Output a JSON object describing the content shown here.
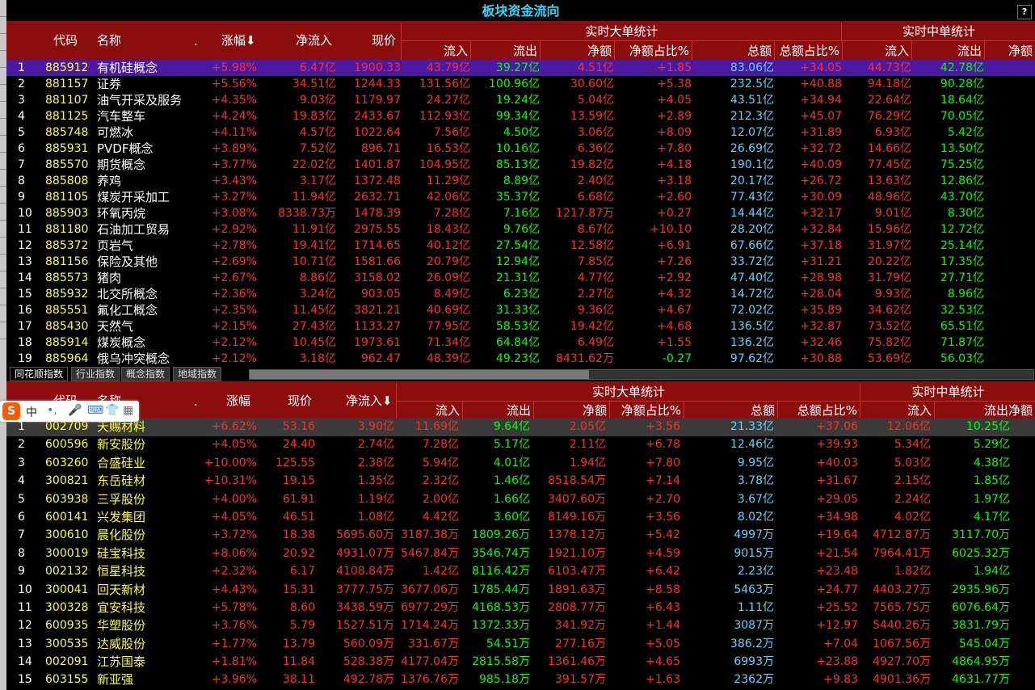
{
  "title": "板块资金流向",
  "help_label": "?",
  "unit_yi": "亿",
  "unit_wan": "万",
  "top": {
    "headers": {
      "seq": "",
      "code": "代码",
      "name": "名称",
      "dot": ".",
      "chg": "涨幅",
      "net": "净流入",
      "price": "现价",
      "big_group": "实时大单统计",
      "mid_group": "实时中单统计",
      "big_sub": [
        "流入",
        "流出",
        "净额",
        "净额占比%",
        "总额",
        "总额占比%"
      ],
      "mid_sub": [
        "流入",
        "流出",
        "净额"
      ]
    },
    "sort_arrow": "⬇",
    "rows": [
      [
        "1",
        "885912",
        "有机硅概念",
        "+5.98%",
        "6.47亿",
        "1900.33",
        "43.79亿",
        "39.27亿",
        "4.51亿",
        "+1.85",
        "83.06亿",
        "+34.05",
        "44.73亿",
        "42.78亿"
      ],
      [
        "2",
        "881157",
        "证券",
        "+5.56%",
        "34.51亿",
        "1244.33",
        "131.56亿",
        "100.96亿",
        "30.60亿",
        "+5.38",
        "232.5亿",
        "+40.88",
        "94.18亿",
        "90.28亿"
      ],
      [
        "3",
        "881107",
        "油气开采及服务",
        "+4.35%",
        "9.03亿",
        "1179.97",
        "24.27亿",
        "19.24亿",
        "5.04亿",
        "+4.05",
        "43.51亿",
        "+34.94",
        "22.64亿",
        "18.64亿"
      ],
      [
        "4",
        "881125",
        "汽车整车",
        "+4.24%",
        "19.83亿",
        "2433.67",
        "112.93亿",
        "99.34亿",
        "13.59亿",
        "+2.89",
        "212.3亿",
        "+45.07",
        "76.29亿",
        "70.05亿"
      ],
      [
        "5",
        "885748",
        "可燃冰",
        "+4.11%",
        "4.57亿",
        "1022.64",
        "7.56亿",
        "4.50亿",
        "3.06亿",
        "+8.09",
        "12.07亿",
        "+31.89",
        "6.93亿",
        "5.42亿"
      ],
      [
        "6",
        "885931",
        "PVDF概念",
        "+3.89%",
        "7.52亿",
        "896.71",
        "16.53亿",
        "10.16亿",
        "6.36亿",
        "+7.80",
        "26.69亿",
        "+32.72",
        "14.66亿",
        "13.50亿"
      ],
      [
        "7",
        "885570",
        "期货概念",
        "+3.77%",
        "22.02亿",
        "1401.87",
        "104.95亿",
        "85.13亿",
        "19.82亿",
        "+4.18",
        "190.1亿",
        "+40.09",
        "77.45亿",
        "75.25亿"
      ],
      [
        "8",
        "885808",
        "养鸡",
        "+3.43%",
        "3.17亿",
        "1372.48",
        "11.29亿",
        "8.89亿",
        "2.40亿",
        "+3.18",
        "20.17亿",
        "+26.72",
        "13.63亿",
        "12.86亿"
      ],
      [
        "9",
        "881105",
        "煤炭开采加工",
        "+3.27%",
        "11.94亿",
        "2632.71",
        "42.06亿",
        "35.37亿",
        "6.68亿",
        "+2.60",
        "77.43亿",
        "+30.09",
        "48.96亿",
        "43.70亿"
      ],
      [
        "10",
        "885903",
        "环氧丙烷",
        "+3.08%",
        "8338.73万",
        "1478.39",
        "7.28亿",
        "7.16亿",
        "1217.87万",
        "+0.27",
        "14.44亿",
        "+32.17",
        "9.01亿",
        "8.30亿"
      ],
      [
        "11",
        "881180",
        "石油加工贸易",
        "+2.92%",
        "11.91亿",
        "2975.55",
        "18.43亿",
        "9.76亿",
        "8.67亿",
        "+10.10",
        "28.20亿",
        "+32.84",
        "15.96亿",
        "12.72亿"
      ],
      [
        "12",
        "885372",
        "页岩气",
        "+2.78%",
        "19.41亿",
        "1714.65",
        "40.12亿",
        "27.54亿",
        "12.58亿",
        "+6.91",
        "67.66亿",
        "+37.18",
        "31.97亿",
        "25.14亿"
      ],
      [
        "13",
        "881156",
        "保险及其他",
        "+2.69%",
        "10.71亿",
        "1581.66",
        "20.79亿",
        "12.94亿",
        "7.85亿",
        "+7.26",
        "33.72亿",
        "+31.21",
        "20.22亿",
        "17.35亿"
      ],
      [
        "14",
        "885573",
        "猪肉",
        "+2.67%",
        "8.86亿",
        "3158.02",
        "26.09亿",
        "21.31亿",
        "4.77亿",
        "+2.92",
        "47.40亿",
        "+28.98",
        "31.79亿",
        "27.71亿"
      ],
      [
        "15",
        "885932",
        "北交所概念",
        "+2.36%",
        "3.24亿",
        "903.05",
        "8.49亿",
        "6.23亿",
        "2.27亿",
        "+4.32",
        "14.72亿",
        "+28.04",
        "9.93亿",
        "8.96亿"
      ],
      [
        "16",
        "885551",
        "氟化工概念",
        "+2.35%",
        "11.45亿",
        "3821.21",
        "40.69亿",
        "31.33亿",
        "9.36亿",
        "+4.67",
        "72.02亿",
        "+35.89",
        "34.62亿",
        "32.53亿"
      ],
      [
        "17",
        "885430",
        "天然气",
        "+2.15%",
        "27.43亿",
        "1133.27",
        "77.95亿",
        "58.53亿",
        "19.42亿",
        "+4.68",
        "136.5亿",
        "+32.87",
        "73.52亿",
        "65.51亿"
      ],
      [
        "18",
        "885914",
        "煤炭概念",
        "+2.12%",
        "10.45亿",
        "1973.61",
        "71.34亿",
        "64.84亿",
        "6.49亿",
        "+1.55",
        "136.2亿",
        "+32.46",
        "75.82亿",
        "71.87亿"
      ],
      [
        "19",
        "885964",
        "俄乌冲突概念",
        "+2.12%",
        "3.18亿",
        "962.47",
        "48.39亿",
        "49.23亿",
        "8431.62万",
        "-0.27",
        "97.62亿",
        "+30.88",
        "53.69亿",
        "56.03亿"
      ]
    ]
  },
  "tabs": [
    "同花顺指数",
    "行业指数",
    "概念指数",
    "地域指数"
  ],
  "ime": {
    "logo": "S",
    "lang": "中",
    "punct": "•,",
    "mic": "🎤",
    "kbd": "⌨",
    "skin": "👕",
    "apps": "▦"
  },
  "bottom": {
    "headers": {
      "code": "代码",
      "name": "名称",
      "dot": ".",
      "chg": "涨幅",
      "price": "现价",
      "net": "净流入",
      "big_group": "实时大单统计",
      "mid_group": "实时中单统计",
      "big_sub": [
        "流入",
        "流出",
        "净额",
        "净额占比%",
        "总额",
        "总额占比%"
      ],
      "mid_sub": [
        "流入",
        "流出净额"
      ]
    },
    "sort_arrow": "⬇",
    "rows": [
      [
        "1",
        "002709",
        "天赐材料",
        "+6.62%",
        "53.16",
        "3.90亿",
        "11.69亿",
        "9.64亿",
        "2.05亿",
        "+3.56",
        "21.33亿",
        "+37.06",
        "12.06亿",
        "10.25亿"
      ],
      [
        "2",
        "600596",
        "新安股份",
        "+4.05%",
        "24.40",
        "2.74亿",
        "7.28亿",
        "5.17亿",
        "2.11亿",
        "+6.78",
        "12.46亿",
        "+39.93",
        "5.34亿",
        "5.29亿"
      ],
      [
        "3",
        "603260",
        "合盛硅业",
        "+10.00%",
        "125.55",
        "2.38亿",
        "5.94亿",
        "4.01亿",
        "1.94亿",
        "+7.80",
        "9.95亿",
        "+40.03",
        "5.03亿",
        "4.38亿"
      ],
      [
        "4",
        "300821",
        "东岳硅材",
        "+10.31%",
        "19.15",
        "1.35亿",
        "2.32亿",
        "1.46亿",
        "8518.54万",
        "+7.14",
        "3.78亿",
        "+31.67",
        "2.15亿",
        "1.85亿"
      ],
      [
        "5",
        "603938",
        "三孚股份",
        "+4.00%",
        "61.91",
        "1.19亿",
        "2.00亿",
        "1.66亿",
        "3407.60万",
        "+2.70",
        "3.67亿",
        "+29.05",
        "2.24亿",
        "1.97亿"
      ],
      [
        "6",
        "600141",
        "兴发集团",
        "+4.05%",
        "46.51",
        "1.08亿",
        "4.42亿",
        "3.60亿",
        "8149.16万",
        "+3.56",
        "8.02亿",
        "+34.98",
        "4.02亿",
        "4.17亿"
      ],
      [
        "7",
        "300610",
        "晨化股份",
        "+3.72%",
        "18.38",
        "5695.60万",
        "3187.38万",
        "1809.26万",
        "1378.12万",
        "+5.42",
        "4997万",
        "+19.64",
        "4712.87万",
        "3117.70万"
      ],
      [
        "8",
        "300019",
        "硅宝科技",
        "+8.06%",
        "20.92",
        "4931.07万",
        "5467.84万",
        "3546.74万",
        "1921.10万",
        "+4.59",
        "9015万",
        "+21.54",
        "7964.41万",
        "6025.32万"
      ],
      [
        "9",
        "002132",
        "恒星科技",
        "+2.32%",
        "6.17",
        "4108.84万",
        "1.42亿",
        "8116.42万",
        "6103.47万",
        "+6.42",
        "2.23亿",
        "+23.48",
        "1.82亿",
        "1.94亿"
      ],
      [
        "10",
        "300041",
        "回天新材",
        "+4.43%",
        "15.31",
        "3777.75万",
        "3677.06万",
        "1785.44万",
        "1891.63万",
        "+8.58",
        "5463万",
        "+24.77",
        "4403.27万",
        "2935.96万"
      ],
      [
        "11",
        "300328",
        "宜安科技",
        "+5.78%",
        "8.60",
        "3438.59万",
        "6977.29万",
        "4168.53万",
        "2808.77万",
        "+6.43",
        "1.11亿",
        "+25.52",
        "7565.75万",
        "6076.64万"
      ],
      [
        "12",
        "600935",
        "华塑股份",
        "+3.76%",
        "5.79",
        "1527.51万",
        "1714.24万",
        "1372.33万",
        "341.92万",
        "+1.44",
        "3087万",
        "+12.97",
        "5440.26万",
        "3831.79万"
      ],
      [
        "13",
        "300535",
        "达威股份",
        "+1.77%",
        "13.79",
        "560.09万",
        "331.67万",
        "54.51万",
        "277.16万",
        "+5.05",
        "386.2万",
        "+7.04",
        "1067.56万",
        "545.04万"
      ],
      [
        "14",
        "002091",
        "江苏国泰",
        "+1.81%",
        "11.84",
        "528.38万",
        "4177.04万",
        "2815.58万",
        "1361.46万",
        "+4.65",
        "6993万",
        "+23.88",
        "4927.70万",
        "4864.95万"
      ],
      [
        "15",
        "603155",
        "新亚强",
        "+3.96%",
        "38.11",
        "492.78万",
        "1376.76万",
        "985.18万",
        "391.57万",
        "+1.63",
        "2362万",
        "+9.83",
        "4901.36万",
        "4631.77万"
      ]
    ]
  }
}
